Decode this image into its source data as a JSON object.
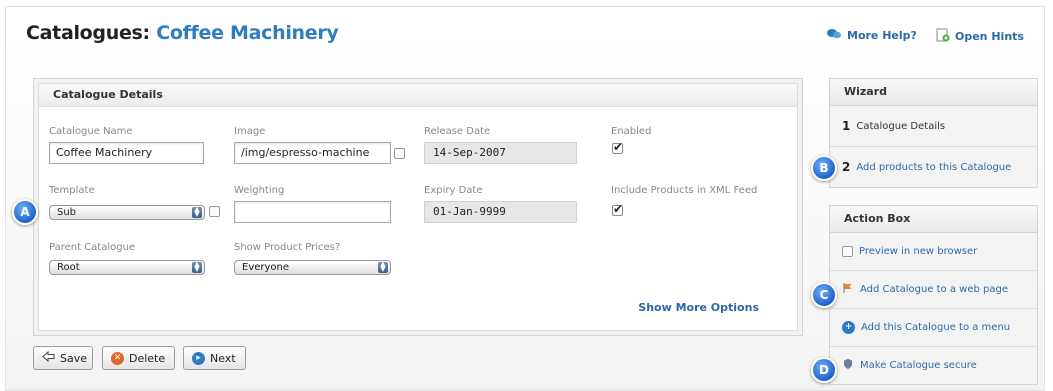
{
  "page": {
    "title_prefix": "Catalogues:",
    "title_name": "Coffee Machinery",
    "more_help": "More Help?",
    "open_hints": "Open Hints"
  },
  "details": {
    "heading": "Catalogue Details",
    "catalogue_name_label": "Catalogue Name",
    "catalogue_name_value": "Coffee Machinery",
    "image_label": "Image",
    "image_value": "/img/espresso-machine",
    "release_date_label": "Release Date",
    "release_date_value": "14-Sep-2007",
    "enabled_label": "Enabled",
    "enabled_checked": true,
    "template_label": "Template",
    "template_value": "Sub",
    "weighting_label": "Weighting",
    "weighting_value": "",
    "expiry_date_label": "Expiry Date",
    "expiry_date_value": "01-Jan-9999",
    "xml_feed_label": "Include Products in XML Feed",
    "xml_feed_checked": true,
    "parent_label": "Parent Catalogue",
    "parent_value": "Root",
    "show_prices_label": "Show Product Prices?",
    "show_prices_value": "Everyone",
    "show_more": "Show More Options"
  },
  "buttons": {
    "save": "Save",
    "delete": "Delete",
    "next": "Next"
  },
  "wizard": {
    "heading": "Wizard",
    "steps": [
      {
        "num": "1",
        "label": "Catalogue Details"
      },
      {
        "num": "2",
        "label": "Add products to this Catalogue"
      }
    ]
  },
  "action_box": {
    "heading": "Action Box",
    "items": [
      {
        "label": "Preview in new browser"
      },
      {
        "label": "Add Catalogue to a web page"
      },
      {
        "label": "Add this Catalogue to a menu"
      },
      {
        "label": "Make Catalogue secure"
      }
    ]
  },
  "markers": [
    "A",
    "B",
    "C",
    "D"
  ],
  "colors": {
    "accent": "#2f7cc0",
    "link": "#2d69a8",
    "marker": "#1e62c9",
    "delete_icon": "#e0662a",
    "next_icon": "#2f78c9"
  }
}
